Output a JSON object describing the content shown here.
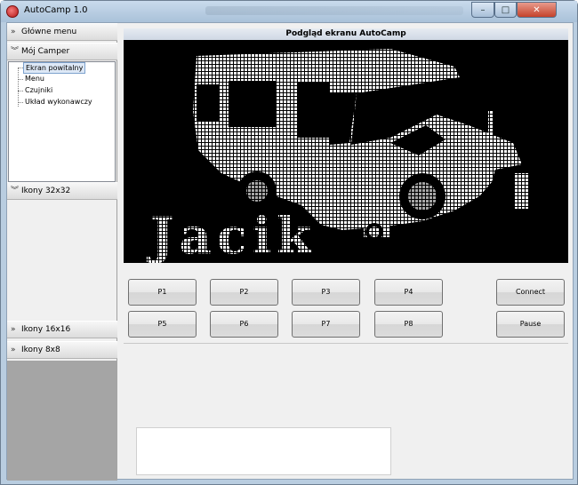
{
  "window": {
    "title": "AutoCamp 1.0",
    "buttons": {
      "minimize": "–",
      "maximize": "□",
      "close": "✕"
    }
  },
  "toolbox": {
    "sections": [
      {
        "label": "Główne menu",
        "icon": "double-chevron-right-icon"
      },
      {
        "label": "Mój Camper",
        "icon": "double-chevron-down-icon"
      },
      {
        "label": "Ikony 32x32",
        "icon": "double-chevron-down-icon"
      },
      {
        "label": "Ikony 16x16",
        "icon": "double-chevron-right-icon"
      },
      {
        "label": "Ikony 8x8",
        "icon": "double-chevron-right-icon"
      }
    ],
    "tree": [
      "Ekran powitalny",
      "Menu",
      "Czujniki",
      "Układ wykonawczy"
    ],
    "selected_tree_item": "Ekran powitalny"
  },
  "preview": {
    "title": "Podgląd ekranu AutoCamp",
    "screen_text": "Jacik",
    "screen_image": "camper-van-dot-matrix"
  },
  "buttons": {
    "p1": "P1",
    "p2": "P2",
    "p3": "P3",
    "p4": "P4",
    "p5": "P5",
    "p6": "P6",
    "p7": "P7",
    "p8": "P8",
    "connect": "Connect",
    "pause": "Pause"
  },
  "colors": {
    "screen_bg": "#000000",
    "pixel_on": "#ffffff",
    "grey_panel": "#a5a5a5"
  }
}
